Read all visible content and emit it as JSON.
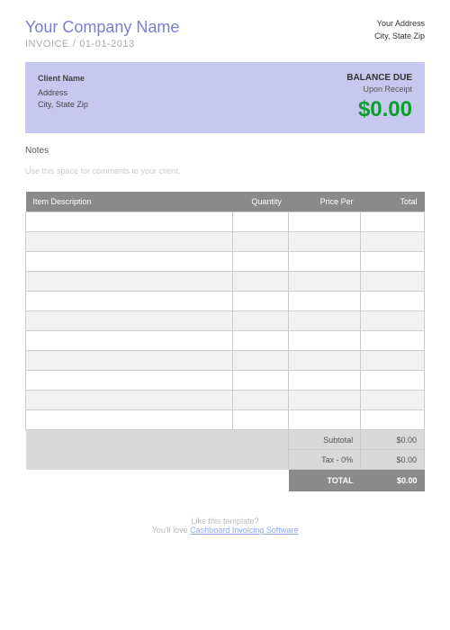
{
  "header": {
    "company": "Your Company Name",
    "invoice_label": "INVOICE",
    "date": "01-01-2013",
    "address1": "Your Address",
    "address2": "City, State Zip"
  },
  "client": {
    "name": "Client Name",
    "address": "Address",
    "city": "City, State Zip",
    "balance_label": "BALANCE DUE",
    "terms": "Upon Receipt",
    "amount": "$0.00"
  },
  "notes": {
    "label": "Notes",
    "placeholder": "Use this space for comments to your client."
  },
  "columns": {
    "desc": "Item Description",
    "qty": "Quantity",
    "price": "Price Per",
    "total": "Total"
  },
  "summary": {
    "subtotal_label": "Subtotal",
    "subtotal": "$0.00",
    "tax_label": "Tax - 0%",
    "tax": "$0.00",
    "total_label": "TOTAL",
    "total": "$0.00"
  },
  "footer": {
    "line1": "Like this template?",
    "line2_prefix": "You'll love ",
    "link": "Cashboard Invoicing Software"
  }
}
